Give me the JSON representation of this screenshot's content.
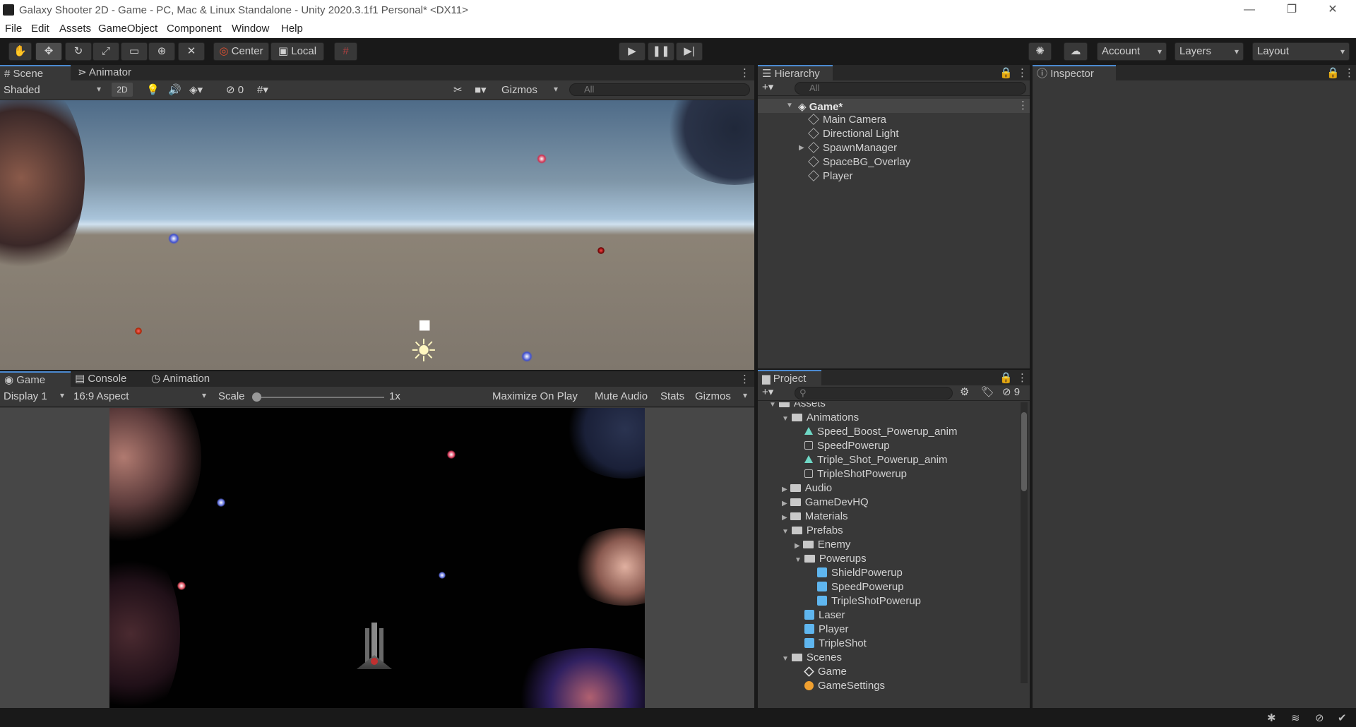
{
  "window": {
    "title": "Galaxy Shooter 2D - Game - PC, Mac & Linux Standalone - Unity 2020.3.1f1 Personal* <DX11>",
    "minimize": "—",
    "restore": "❐",
    "close": "✕"
  },
  "menu": [
    "File",
    "Edit",
    "Assets",
    "GameObject",
    "Component",
    "Window",
    "Help"
  ],
  "toolbar": {
    "pivot": "Center",
    "space": "Local",
    "account": "Account",
    "layers": "Layers",
    "layout": "Layout"
  },
  "scene_panel": {
    "tabs": [
      "Scene",
      "Animator"
    ],
    "shading": "Shaded",
    "mode_2d": "2D",
    "hidden_count": "0",
    "gizmos": "Gizmos",
    "search_placeholder": "All"
  },
  "game_panel": {
    "tabs": [
      "Game",
      "Console",
      "Animation"
    ],
    "display": "Display 1",
    "aspect": "16:9 Aspect",
    "scale_label": "Scale",
    "scale_value": "1x",
    "maximize": "Maximize On Play",
    "mute": "Mute Audio",
    "stats": "Stats",
    "gizmos": "Gizmos"
  },
  "hierarchy": {
    "title": "Hierarchy",
    "search_placeholder": "All",
    "scene": "Game*",
    "items": [
      "Main Camera",
      "Directional Light",
      "SpawnManager",
      "SpaceBG_Overlay",
      "Player"
    ]
  },
  "inspector": {
    "title": "Inspector"
  },
  "project": {
    "title": "Project",
    "hidden_count": "9",
    "root": "Assets",
    "items": [
      {
        "label": "Animations",
        "depth": 1,
        "kind": "folder",
        "expanded": true
      },
      {
        "label": "Speed_Boost_Powerup_anim",
        "depth": 2,
        "kind": "anim"
      },
      {
        "label": "SpeedPowerup",
        "depth": 2,
        "kind": "controller"
      },
      {
        "label": "Triple_Shot_Powerup_anim",
        "depth": 2,
        "kind": "anim"
      },
      {
        "label": "TripleShotPowerup",
        "depth": 2,
        "kind": "controller"
      },
      {
        "label": "Audio",
        "depth": 1,
        "kind": "folder",
        "expanded": false
      },
      {
        "label": "GameDevHQ",
        "depth": 1,
        "kind": "folder",
        "expanded": false
      },
      {
        "label": "Materials",
        "depth": 1,
        "kind": "folder",
        "expanded": false
      },
      {
        "label": "Prefabs",
        "depth": 1,
        "kind": "folder",
        "expanded": true
      },
      {
        "label": "Enemy",
        "depth": 2,
        "kind": "folder",
        "expanded": false
      },
      {
        "label": "Powerups",
        "depth": 2,
        "kind": "folder",
        "expanded": true
      },
      {
        "label": "ShieldPowerup",
        "depth": 3,
        "kind": "prefab"
      },
      {
        "label": "SpeedPowerup",
        "depth": 3,
        "kind": "prefab"
      },
      {
        "label": "TripleShotPowerup",
        "depth": 3,
        "kind": "prefab"
      },
      {
        "label": "Laser",
        "depth": 2,
        "kind": "prefab"
      },
      {
        "label": "Player",
        "depth": 2,
        "kind": "prefab"
      },
      {
        "label": "TripleShot",
        "depth": 2,
        "kind": "prefab"
      },
      {
        "label": "Scenes",
        "depth": 1,
        "kind": "folder",
        "expanded": true
      },
      {
        "label": "Game",
        "depth": 2,
        "kind": "scene"
      },
      {
        "label": "GameSettings",
        "depth": 2,
        "kind": "settings"
      }
    ]
  },
  "colors": {
    "accent": "#4b8ad1",
    "prefab": "#5fb6ef",
    "panel_bg": "#383838",
    "tab_bg": "#282828"
  }
}
